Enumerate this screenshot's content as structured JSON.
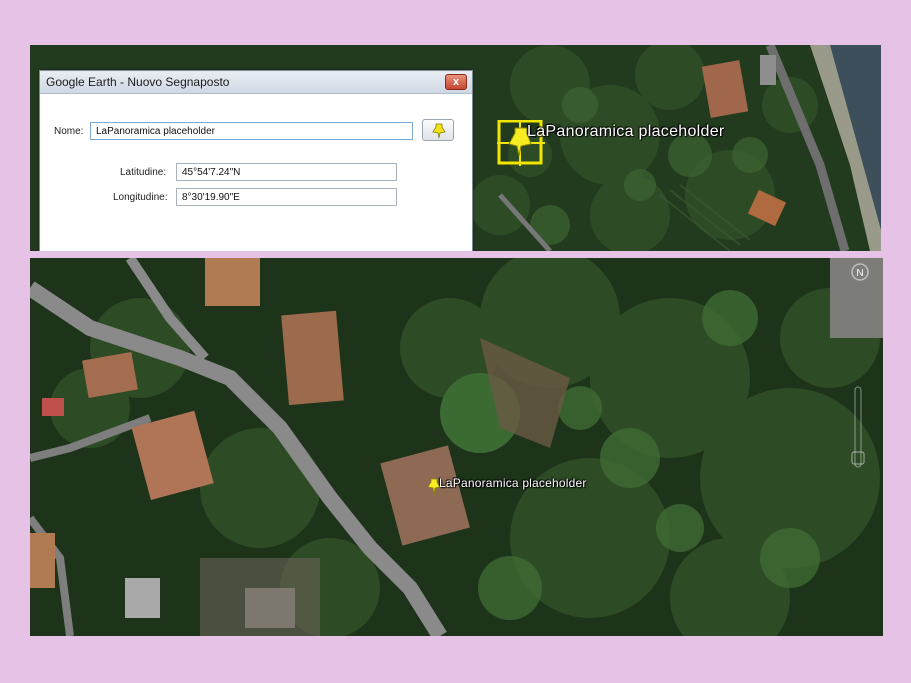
{
  "dialog": {
    "title": "Google Earth - Nuovo Segnaposto",
    "close_label": "x",
    "name_label": "Nome:",
    "name_value": "LaPanoramica placeholder",
    "latitude_label": "Latitudine:",
    "latitude_value": "45°54'7.24\"N",
    "longitude_label": "Longitudine:",
    "longitude_value": "8°30'19.90\"E",
    "icon_button": "pushpin-icon"
  },
  "top_map": {
    "placemark_label": "LaPanoramica placeholder",
    "marker_icon": "yellow-pushpin-icon"
  },
  "bottom_map": {
    "placemark_label": "LaPanoramica placeholder",
    "marker_icon": "yellow-pushpin-icon",
    "compass_label": "N"
  },
  "colors": {
    "background": "#e6c3e6",
    "marker_yellow": "#f2e600",
    "vegetation": "#1f3a1c",
    "roof": "#a86b48"
  }
}
